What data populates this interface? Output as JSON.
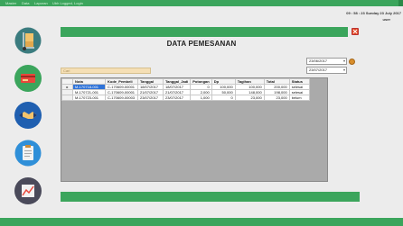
{
  "menubar": {
    "items": [
      "Master",
      "Data",
      "Laporan",
      "Ubh Logged, Login"
    ]
  },
  "header": {
    "clock": "09 : 58 : 23  Sunday 23 July 2017",
    "user": "user"
  },
  "sidebar": {
    "items": [
      {
        "icon": "hand-truck-icon",
        "bg": "#e8e8e8"
      },
      {
        "icon": "money-card-icon",
        "bg": "#3ba55c"
      },
      {
        "icon": "handshake-icon",
        "bg": "#1f5fb0"
      },
      {
        "icon": "clipboard-icon",
        "bg": "#e8e8e8"
      },
      {
        "icon": "chart-icon",
        "bg": "#4a4a5a"
      }
    ]
  },
  "page": {
    "title": "DATA PEMESANAN"
  },
  "filters": {
    "date_from": "23/06/2017",
    "date_to": "23/07/2017",
    "search_placeholder": "Cari"
  },
  "table": {
    "columns": [
      "Nota",
      "Kode_Pembeli",
      "Tanggal",
      "Tanggal_Jadi",
      "Potongan",
      "Dp",
      "Tagihan",
      "Total",
      "Status"
    ],
    "rows": [
      [
        "M-170718-001",
        "C-170609-00001",
        "18/07/2017",
        "18/07/2017",
        "0",
        "100,000",
        "100,000",
        "200,000",
        "selesai"
      ],
      [
        "M-170721-001",
        "C-170609-00001",
        "21/07/2017",
        "21/07/2017",
        "2,000",
        "50,000",
        "148,000",
        "198,000",
        "selesai"
      ],
      [
        "M-170723-001",
        "C-170609-00003",
        "23/07/2017",
        "23/07/2017",
        "1,000",
        "0",
        "23,000",
        "23,000",
        "belum"
      ]
    ]
  },
  "colors": {
    "accent_green": "#3ba55c",
    "selection_blue": "#2f73d8",
    "exit_red": "#e44c27"
  }
}
